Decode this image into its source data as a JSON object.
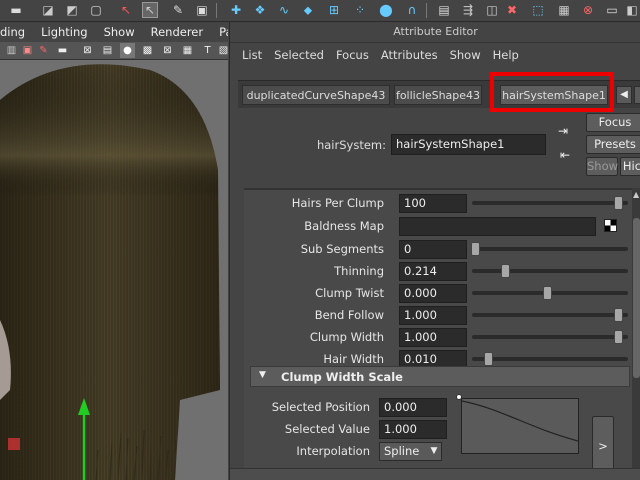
{
  "viewport": {
    "menu": [
      "ding",
      "Lighting",
      "Show",
      "Renderer",
      "Panels"
    ]
  },
  "attribute_editor": {
    "title": "Attribute Editor",
    "menu": [
      "List",
      "Selected",
      "Focus",
      "Attributes",
      "Show",
      "Help"
    ],
    "tabs": [
      "duplicatedCurveShape43",
      "follicleShape43",
      "hairSystemShape1"
    ],
    "active_tab": "hairSystemShape1",
    "node_type_label": "hairSystem:",
    "node_name": "hairSystemShape1",
    "buttons": {
      "focus": "Focus",
      "presets": "Presets",
      "show": "Show",
      "hide": "Hic"
    }
  },
  "attributes": [
    {
      "label": "Hairs Per Clump",
      "value": "100",
      "slider": 1.0
    },
    {
      "label": "Baldness Map",
      "value": ""
    },
    {
      "label": "Sub Segments",
      "value": "0",
      "slider": 0.0
    },
    {
      "label": "Thinning",
      "value": "0.214",
      "slider": 0.214
    },
    {
      "label": "Clump Twist",
      "value": "0.000",
      "slider": 0.5
    },
    {
      "label": "Bend Follow",
      "value": "1.000",
      "slider": 1.0
    },
    {
      "label": "Clump Width",
      "value": "1.000",
      "slider": 1.0
    },
    {
      "label": "Hair Width",
      "value": "0.010",
      "slider": 0.1
    }
  ],
  "clump_width_scale": {
    "section_title": "Clump Width Scale",
    "selected_position_label": "Selected Position",
    "selected_position": "0.000",
    "selected_value_label": "Selected Value",
    "selected_value": "1.000",
    "interpolation_label": "Interpolation",
    "interpolation": "Spline",
    "expand_label": ">"
  },
  "colors": {
    "highlight": "#e00000",
    "hair": "#3d3420"
  }
}
